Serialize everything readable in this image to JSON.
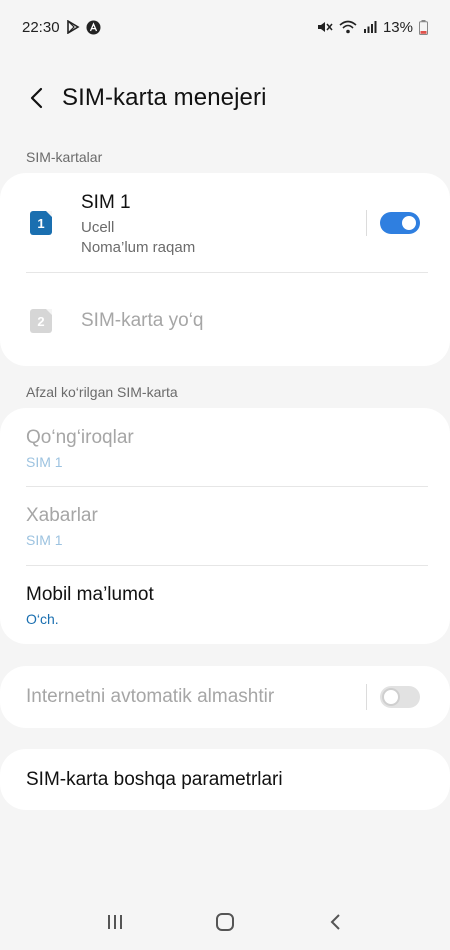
{
  "status_bar": {
    "time": "22:30",
    "battery": "13%"
  },
  "header": {
    "title": "SIM-karta menejeri"
  },
  "sections": {
    "sim_cards_label": "SIM-kartalar",
    "preferred_label": "Afzal ko‘rilgan SIM-karta"
  },
  "sim1": {
    "badge": "1",
    "name": "SIM 1",
    "carrier": "Ucell",
    "number": "Noma’lum raqam",
    "enabled": true
  },
  "sim2": {
    "badge": "2",
    "label": "SIM-karta yo‘q"
  },
  "preferred": {
    "calls": {
      "label": "Qo‘ng‘iroqlar",
      "value": "SIM 1"
    },
    "messages": {
      "label": "Xabarlar",
      "value": "SIM 1"
    },
    "mobile_data": {
      "label": "Mobil ma’lumot",
      "value": "O‘ch."
    }
  },
  "auto_switch": {
    "label": "Internetni avtomatik almashtir",
    "enabled": false
  },
  "more": {
    "label": "SIM-karta boshqa parametrlari"
  },
  "colors": {
    "accent": "#2f7fe0",
    "sim1_badge": "#1a6fb0",
    "sim2_badge": "#d6d6d6",
    "link_blue": "#1a6fb0"
  }
}
